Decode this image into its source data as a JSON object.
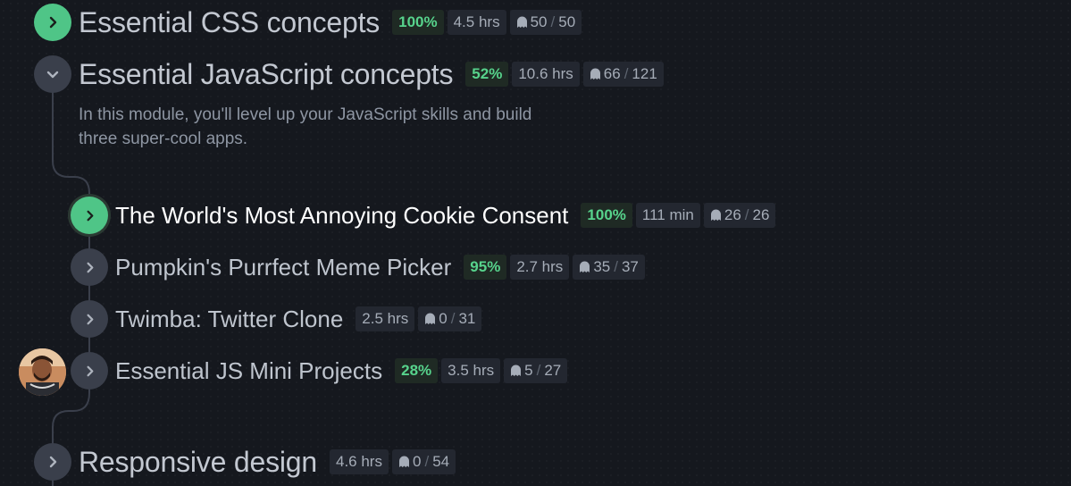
{
  "modules": [
    {
      "title": "Essential CSS concepts",
      "percent": "100%",
      "duration": "4.5 hrs",
      "challenges_done": "50",
      "challenges_total": "50",
      "state": "completed",
      "expanded": false
    },
    {
      "title": "Essential JavaScript concepts",
      "percent": "52%",
      "duration": "10.6 hrs",
      "challenges_done": "66",
      "challenges_total": "121",
      "state": "in-progress",
      "expanded": true,
      "description": "In this module, you'll level up your JavaScript skills and build three super-cool apps.",
      "lessons": [
        {
          "title": "The World's Most Annoying Cookie Consent",
          "percent": "100%",
          "duration": "111 min",
          "challenges_done": "26",
          "challenges_total": "26",
          "state": "completed"
        },
        {
          "title": "Pumpkin's Purrfect Meme Picker",
          "percent": "95%",
          "duration": "2.7 hrs",
          "challenges_done": "35",
          "challenges_total": "37",
          "state": "in-progress"
        },
        {
          "title": "Twimba: Twitter Clone",
          "duration": "2.5 hrs",
          "challenges_done": "0",
          "challenges_total": "31",
          "state": "not-started"
        },
        {
          "title": "Essential JS Mini Projects",
          "percent": "28%",
          "duration": "3.5 hrs",
          "challenges_done": "5",
          "challenges_total": "27",
          "state": "in-progress"
        }
      ]
    },
    {
      "title": "Responsive design",
      "duration": "4.6 hrs",
      "challenges_done": "0",
      "challenges_total": "54",
      "state": "not-started",
      "expanded": false
    }
  ],
  "icons": {
    "expand": "chevron-right-icon",
    "collapse": "chevron-down-icon",
    "challenges": "ghost-icon",
    "user": "avatar"
  },
  "colors": {
    "accent_green": "#4fc587",
    "percent_text": "#57d38c",
    "neutral_circle": "#3a3f4b",
    "background": "#15181e"
  }
}
